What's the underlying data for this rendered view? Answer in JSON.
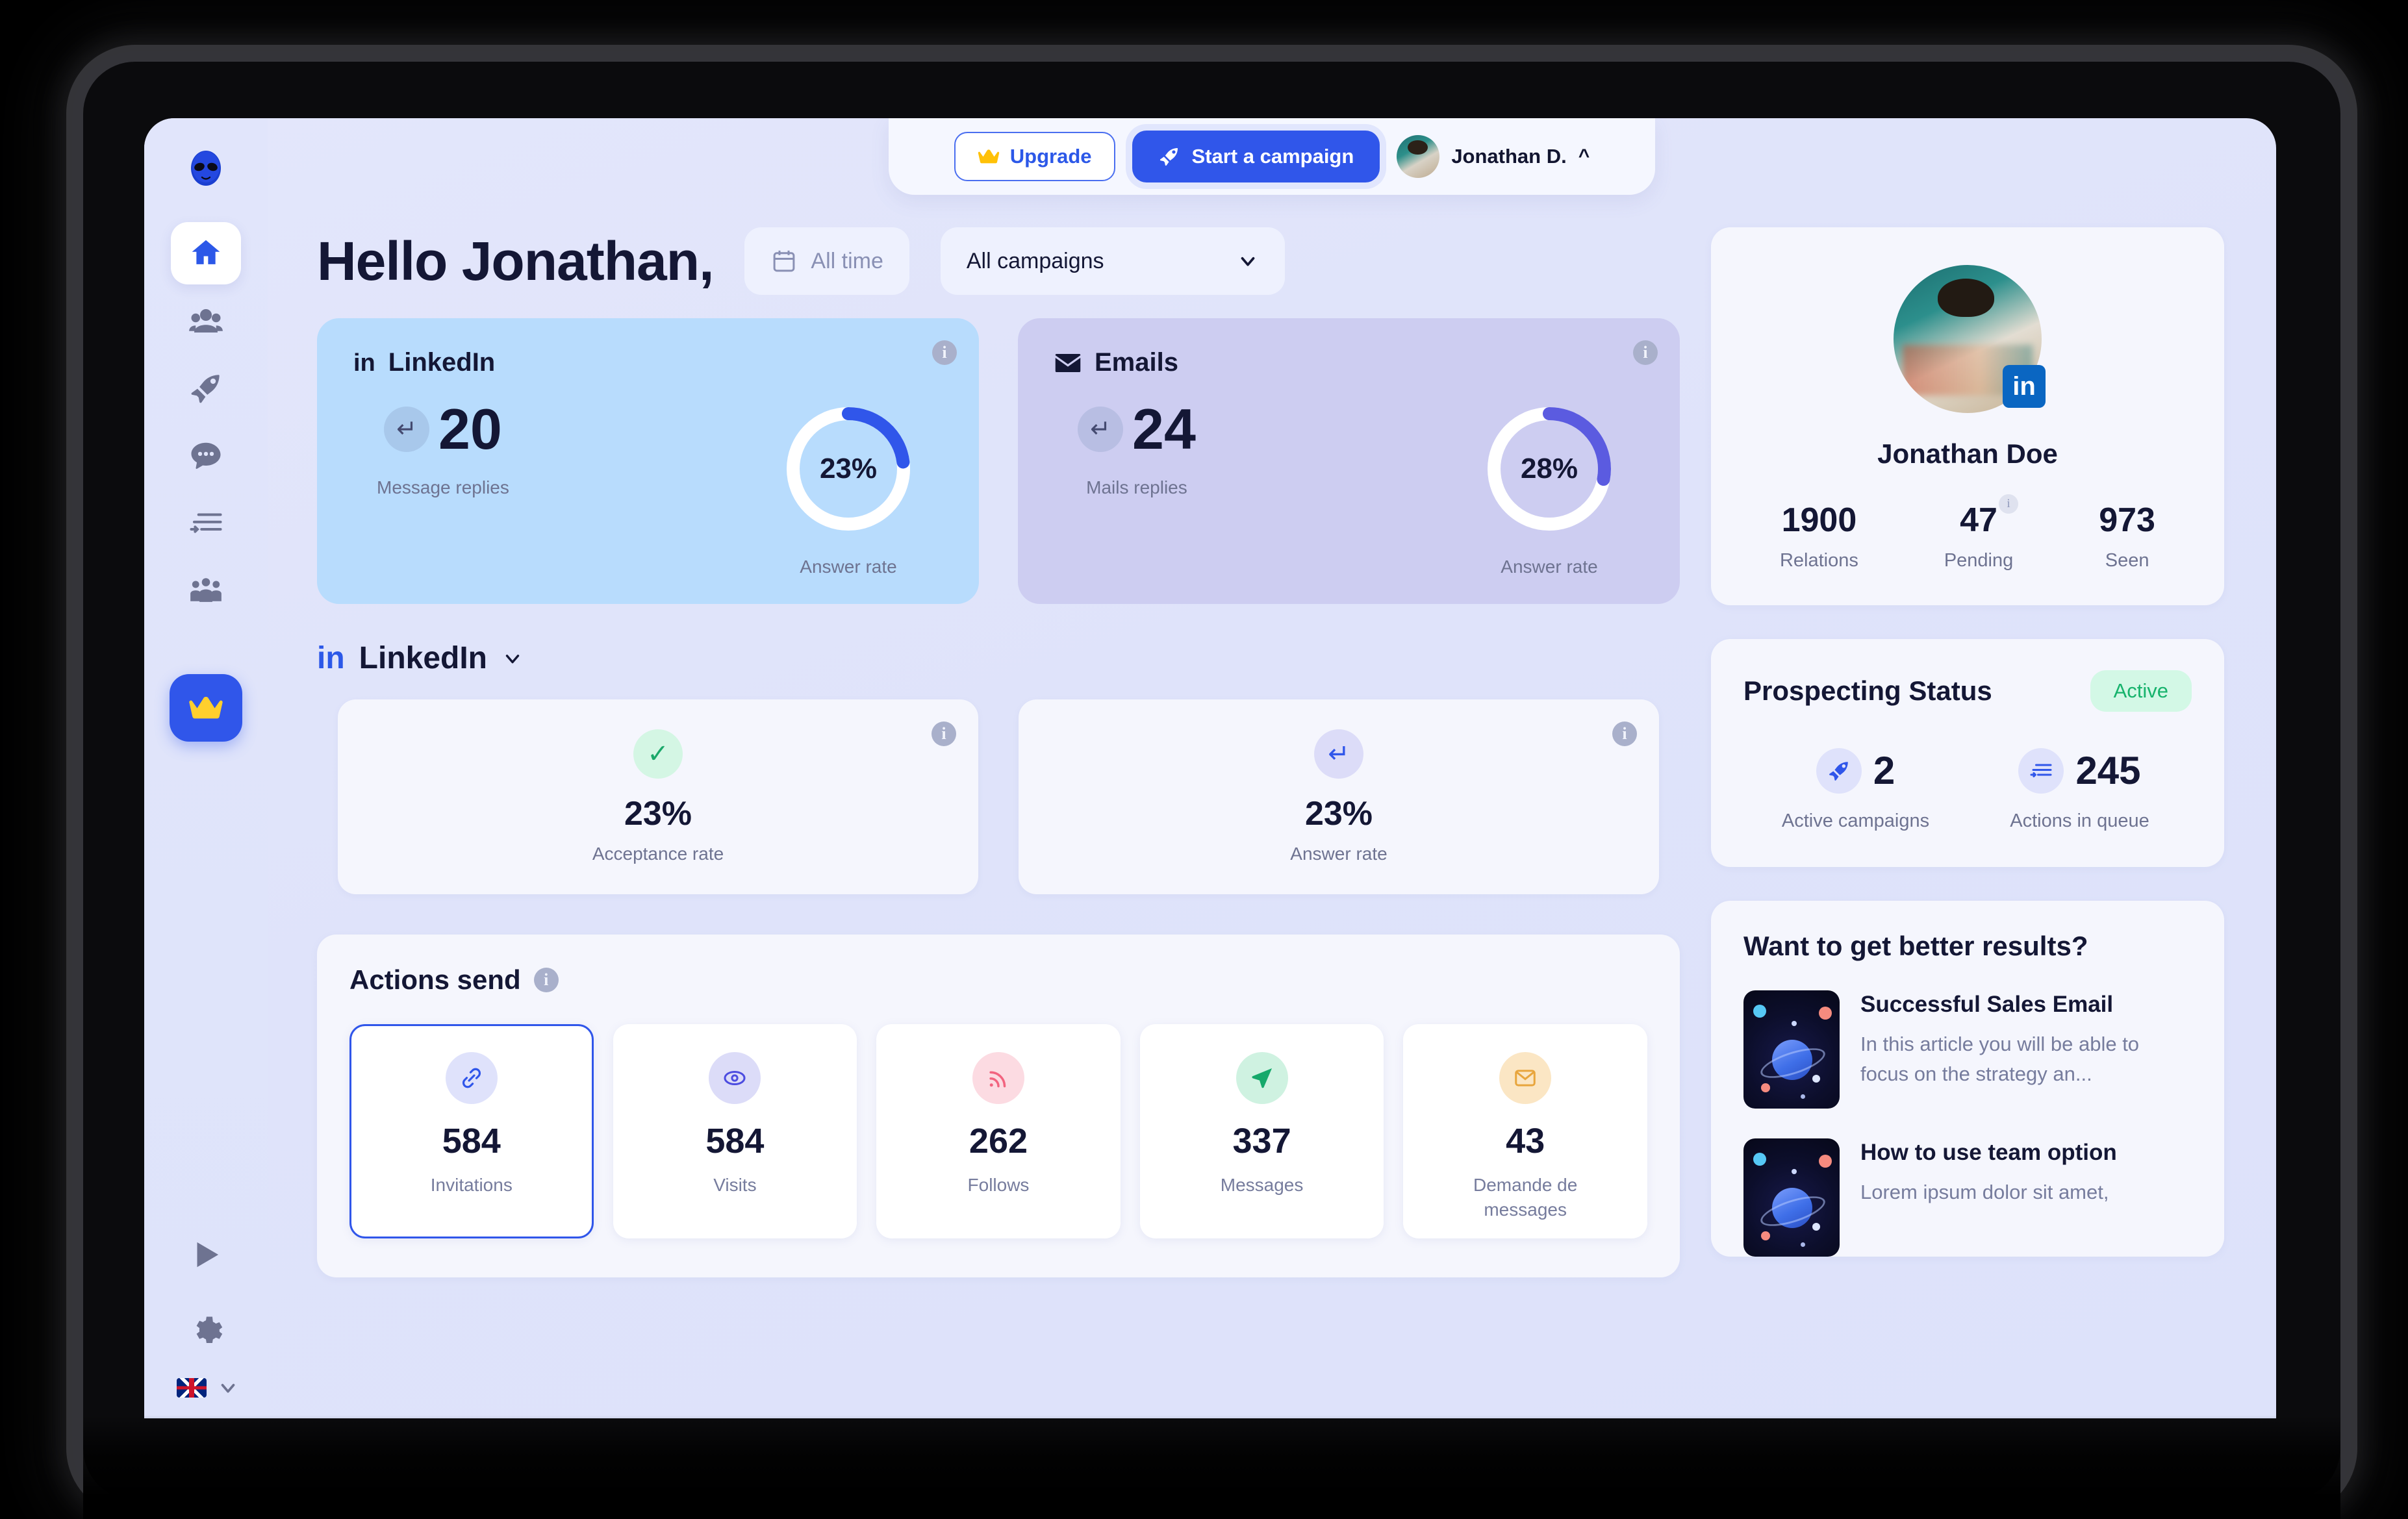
{
  "topbar": {
    "upgrade_label": "Upgrade",
    "campaign_label": "Start a campaign",
    "user_name": "Jonathan D."
  },
  "sidebar": {
    "logo_icon": "alien-icon",
    "items": [
      {
        "icon": "home-icon",
        "name": "home",
        "active": true
      },
      {
        "icon": "contacts-icon",
        "name": "contacts",
        "active": false
      },
      {
        "icon": "rocket-icon",
        "name": "campaigns",
        "active": false
      },
      {
        "icon": "chat-icon",
        "name": "messages",
        "active": false
      },
      {
        "icon": "queue-icon",
        "name": "queue",
        "active": false
      },
      {
        "icon": "team-icon",
        "name": "team",
        "active": false
      }
    ],
    "upgrade_icon": "crown-icon",
    "play_icon": "play-icon",
    "settings_icon": "gear-icon",
    "language_flag": "uk-flag-icon"
  },
  "header": {
    "greeting": "Hello Jonathan,",
    "date_filter": "All time",
    "campaign_filter": "All campaigns"
  },
  "channels": [
    {
      "name": "LinkedIn",
      "icon": "linkedin-icon",
      "metric_value": "20",
      "metric_label": "Message replies",
      "rate_value": "23%",
      "rate_label": "Answer rate",
      "rate_pct": 23,
      "arc_color": "#3056ea",
      "track_color": "#ffffff",
      "bg_color": "#b8dcfd"
    },
    {
      "name": "Emails",
      "icon": "envelope-icon",
      "metric_value": "24",
      "metric_label": "Mails replies",
      "rate_value": "28%",
      "rate_label": "Answer rate",
      "rate_pct": 28,
      "arc_color": "#5b5be0",
      "track_color": "#ffffff",
      "bg_color": "#cdcdf1"
    }
  ],
  "linkedin_section": {
    "brand": "in",
    "title": "LinkedIn",
    "rates": [
      {
        "value": "23%",
        "label": "Acceptance rate",
        "icon": "check-icon",
        "tone": "green"
      },
      {
        "value": "23%",
        "label": "Answer rate",
        "icon": "reply-icon",
        "tone": "violet"
      }
    ]
  },
  "actions": {
    "title": "Actions send",
    "tiles": [
      {
        "value": "584",
        "label": "Invitations",
        "icon": "link-icon",
        "bg": "#dfe2fb",
        "fg": "#3056ea",
        "selected": true
      },
      {
        "value": "584",
        "label": "Visits",
        "icon": "eye-icon",
        "bg": "#dcdcf8",
        "fg": "#4c4ce0",
        "selected": false
      },
      {
        "value": "262",
        "label": "Follows",
        "icon": "rss-icon",
        "bg": "#fcdbe2",
        "fg": "#f2637f",
        "selected": false
      },
      {
        "value": "337",
        "label": "Messages",
        "icon": "send-icon",
        "bg": "#cff2e1",
        "fg": "#16a96b",
        "selected": false
      },
      {
        "value": "43",
        "label": "Demande de messages",
        "icon": "envelope-icon",
        "bg": "#fbe6c4",
        "fg": "#e8a53c",
        "selected": false
      }
    ]
  },
  "profile": {
    "name": "Jonathan Doe",
    "network_badge": "in",
    "stats": [
      {
        "value": "1900",
        "label": "Relations",
        "badge": ""
      },
      {
        "value": "47",
        "label": "Pending",
        "badge": "i"
      },
      {
        "value": "973",
        "label": "Seen",
        "badge": ""
      }
    ]
  },
  "prospecting": {
    "title": "Prospecting Status",
    "status": "Active",
    "status_color": "#16b36c",
    "items": [
      {
        "value": "2",
        "label": "Active campaigns",
        "icon": "rocket-icon"
      },
      {
        "value": "245",
        "label": "Actions in queue",
        "icon": "queue-icon"
      }
    ]
  },
  "articles": {
    "title": "Want to get better results?",
    "items": [
      {
        "title": "Successful Sales Email",
        "desc": "In this article you will be able to focus on the strategy an..."
      },
      {
        "title": "How to use team option",
        "desc": "Lorem ipsum dolor sit amet,"
      }
    ]
  }
}
